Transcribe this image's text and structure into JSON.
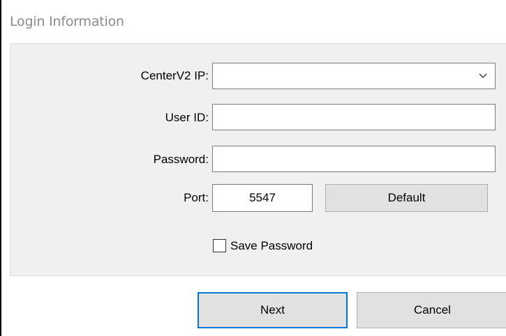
{
  "window": {
    "title": "Login Information"
  },
  "form": {
    "center_ip_label": "CenterV2 IP:",
    "center_ip_value": "",
    "user_id_label": "User ID:",
    "user_id_value": "",
    "password_label": "Password:",
    "password_value": "",
    "port_label": "Port:",
    "port_value": "5547",
    "default_button": "Default",
    "save_password_label": "Save Password",
    "save_password_checked": false
  },
  "footer": {
    "next_button": "Next",
    "cancel_button": "Cancel"
  },
  "colors": {
    "panel_bg": "#f0f0f0",
    "button_bg": "#e1e1e1",
    "focus_border": "#0078d7",
    "title_text": "#8a8a8a"
  },
  "icons": {
    "combo_dropdown": "chevron-down-icon"
  }
}
